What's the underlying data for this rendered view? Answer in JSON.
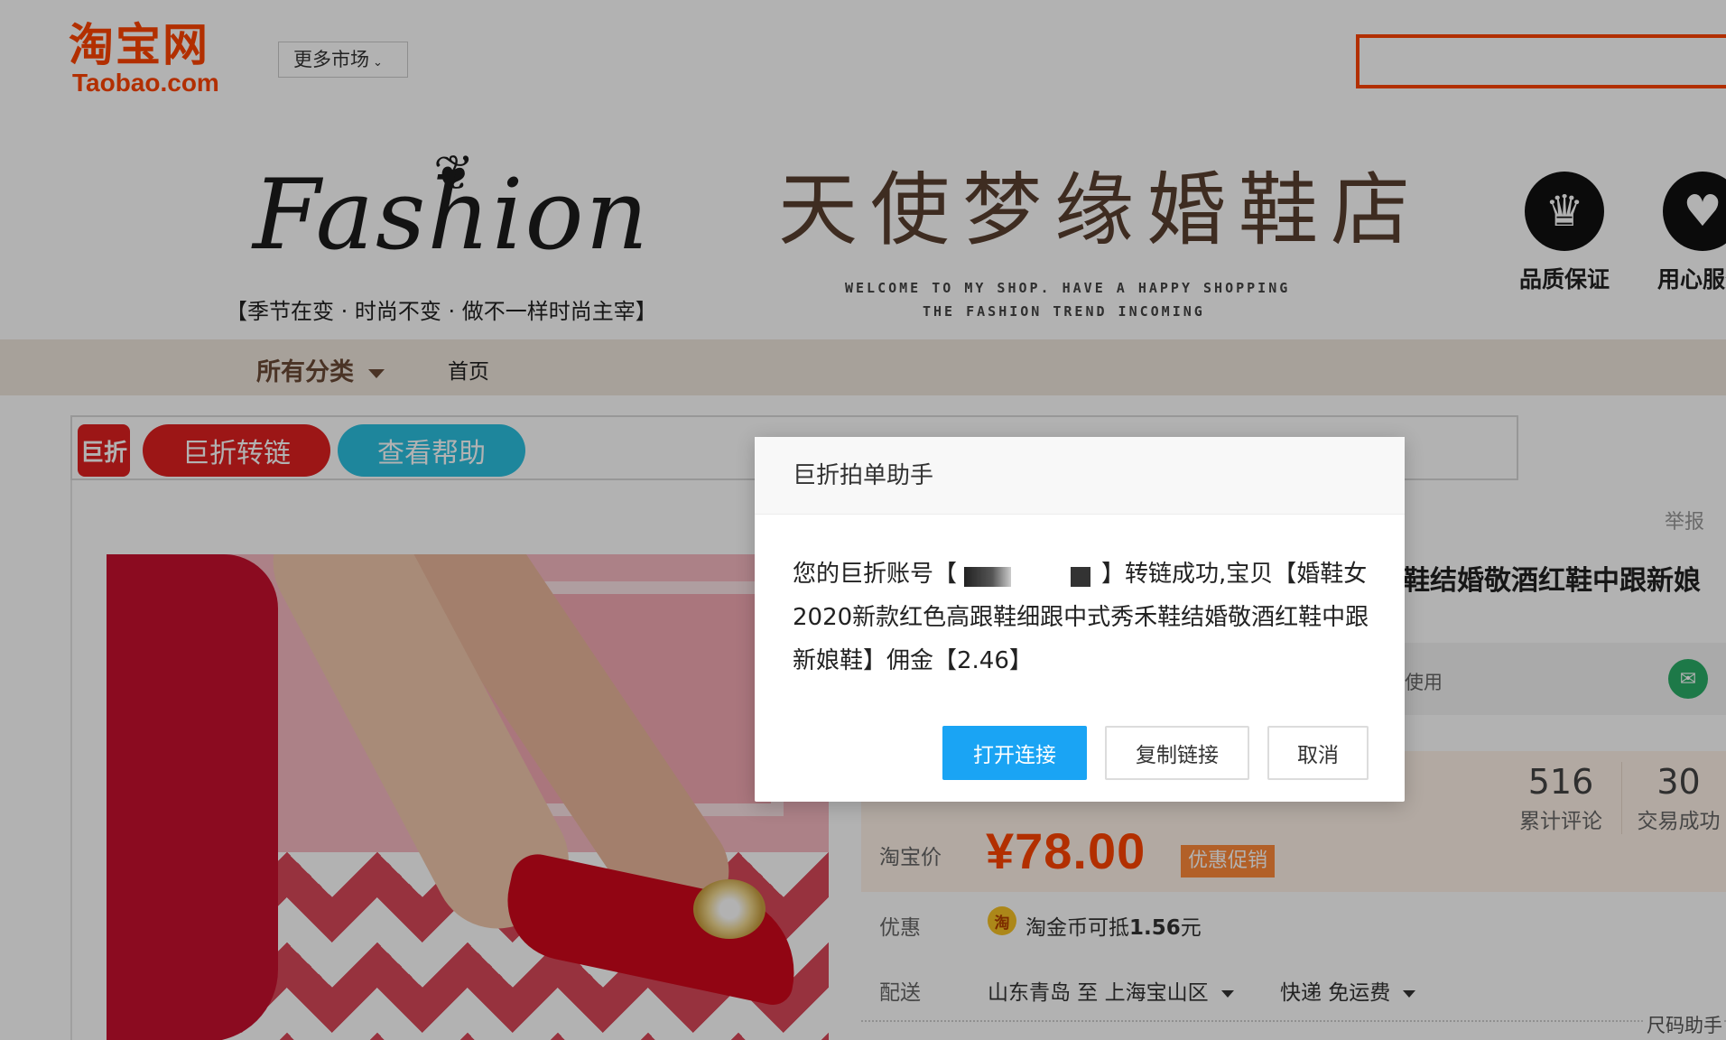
{
  "header": {
    "logo_cn": "淘宝网",
    "logo_en": "Taobao.com",
    "market_select": "更多市场",
    "search_placeholder": ""
  },
  "shop_banner": {
    "fashion_word": "Fashion",
    "slogan": "【季节在变 · 时尚不变 · 做不一样时尚主宰】",
    "title": "天使梦缘婚鞋店",
    "welcome_line1": "WELCOME TO MY SHOP. HAVE A HAPPY SHOPPING",
    "welcome_line2": "THE FASHION TREND INCOMING",
    "badges": [
      {
        "label": "品质保证",
        "icon": "crown-icon"
      },
      {
        "label": "用心服务",
        "icon": "heart-icon"
      }
    ]
  },
  "shop_nav": {
    "all_categories": "所有分类",
    "home": "首页"
  },
  "plugin_bar": {
    "logo_text": "巨折",
    "convert_button": "巨折转链",
    "help_button": "查看帮助"
  },
  "product": {
    "report": "举报",
    "title_partial": "鞋结婚敬酒红鞋中跟新娘",
    "wechat_use": "使用",
    "stats": {
      "reviews_count": "516",
      "reviews_label": "累计评论",
      "trades_count": "30",
      "trades_label": "交易成功"
    },
    "price_label": "淘宝价",
    "price": "¥78.00",
    "price_tag": "优惠促销",
    "discount_label": "优惠",
    "discount_coin": "淘",
    "discount_text_prefix": "淘金币可抵",
    "discount_amount": "1.56",
    "discount_unit": "元",
    "shipping_label": "配送",
    "shipping_route": "山东青岛 至 上海宝山区",
    "shipping_method": "快递 免运费",
    "size_helper": "尺码助手"
  },
  "modal": {
    "title": "巨折拍单助手",
    "msg_part1": "您的巨折账号【",
    "msg_part2": "】转链成功,宝贝【婚鞋女2020新款红色高跟鞋细跟中式秀禾鞋结婚敬酒红鞋中跟新娘鞋】佣金【2.46】",
    "buttons": {
      "open": "打开连接",
      "copy": "复制链接",
      "cancel": "取消"
    }
  },
  "colors": {
    "taobao_orange": "#ff4400",
    "plugin_red": "#e02020",
    "help_blue": "#2cc0e0",
    "primary_button": "#1aa4f4"
  }
}
